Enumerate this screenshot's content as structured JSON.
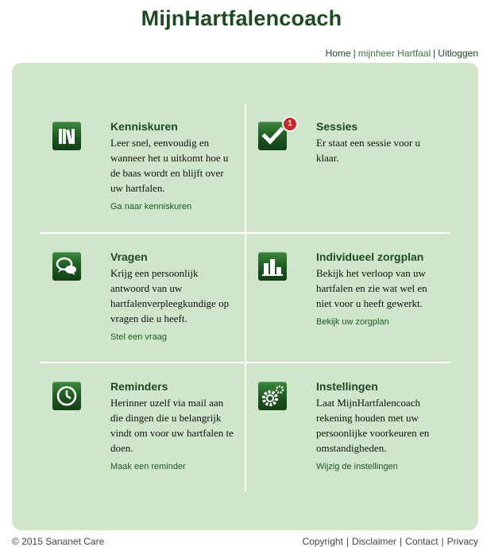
{
  "header": {
    "title": "MijnHartfalencoach",
    "nav": [
      {
        "label": "Home"
      },
      {
        "label": "mijnheer Hartfaal"
      },
      {
        "label": "Uitloggen"
      }
    ],
    "separator": "|"
  },
  "tiles": [
    {
      "icon": "books-icon",
      "title": "Kenniskuren",
      "text": "Leer snel, eenvoudig en wanneer het u uitkomt hoe u de baas wordt en blijft over uw hartfalen.",
      "link": "Ga naar kenniskuren"
    },
    {
      "icon": "checkmark-icon",
      "badge": "1",
      "title": "Sessies",
      "text": "Er staat een sessie voor u klaar.",
      "link": ""
    },
    {
      "icon": "speech-bubbles-icon",
      "title": "Vragen",
      "text": "Krijg een persoonlijk antwoord van uw hartfalenverpleegkundige op vragen die u heeft.",
      "link": "Stel een vraag"
    },
    {
      "icon": "bar-chart-icon",
      "title": "Individueel zorgplan",
      "text": "Bekijk het verloop van uw hartfalen en zie wat wel en niet voor u heeft gewerkt.",
      "link": "Bekijk uw zorgplan"
    },
    {
      "icon": "clock-icon",
      "title": "Reminders",
      "text": "Herinner uzelf via mail aan die dingen die u belangrijk vindt om voor uw hartfalen te doen.",
      "link": "Maak een reminder"
    },
    {
      "icon": "gears-icon",
      "title": "Instellingen",
      "text": "Laat MijnHartfalencoach rekening houden met uw persoonlijke voorkeuren en omstandigheden.",
      "link": "Wijzig de instellingen"
    }
  ],
  "footer": {
    "copyright": "© 2015 Sananet Care",
    "links": [
      {
        "label": "Copyright"
      },
      {
        "label": "Disclaimer"
      },
      {
        "label": "Contact"
      },
      {
        "label": "Privacy"
      }
    ],
    "separator": "|"
  },
  "colors": {
    "brand_green": "#1e4a22",
    "panel_bg": "#cfe6cb",
    "icon_gradient_top": "#3d8a3d",
    "icon_gradient_bottom": "#133f17",
    "badge_red": "#c62828"
  }
}
